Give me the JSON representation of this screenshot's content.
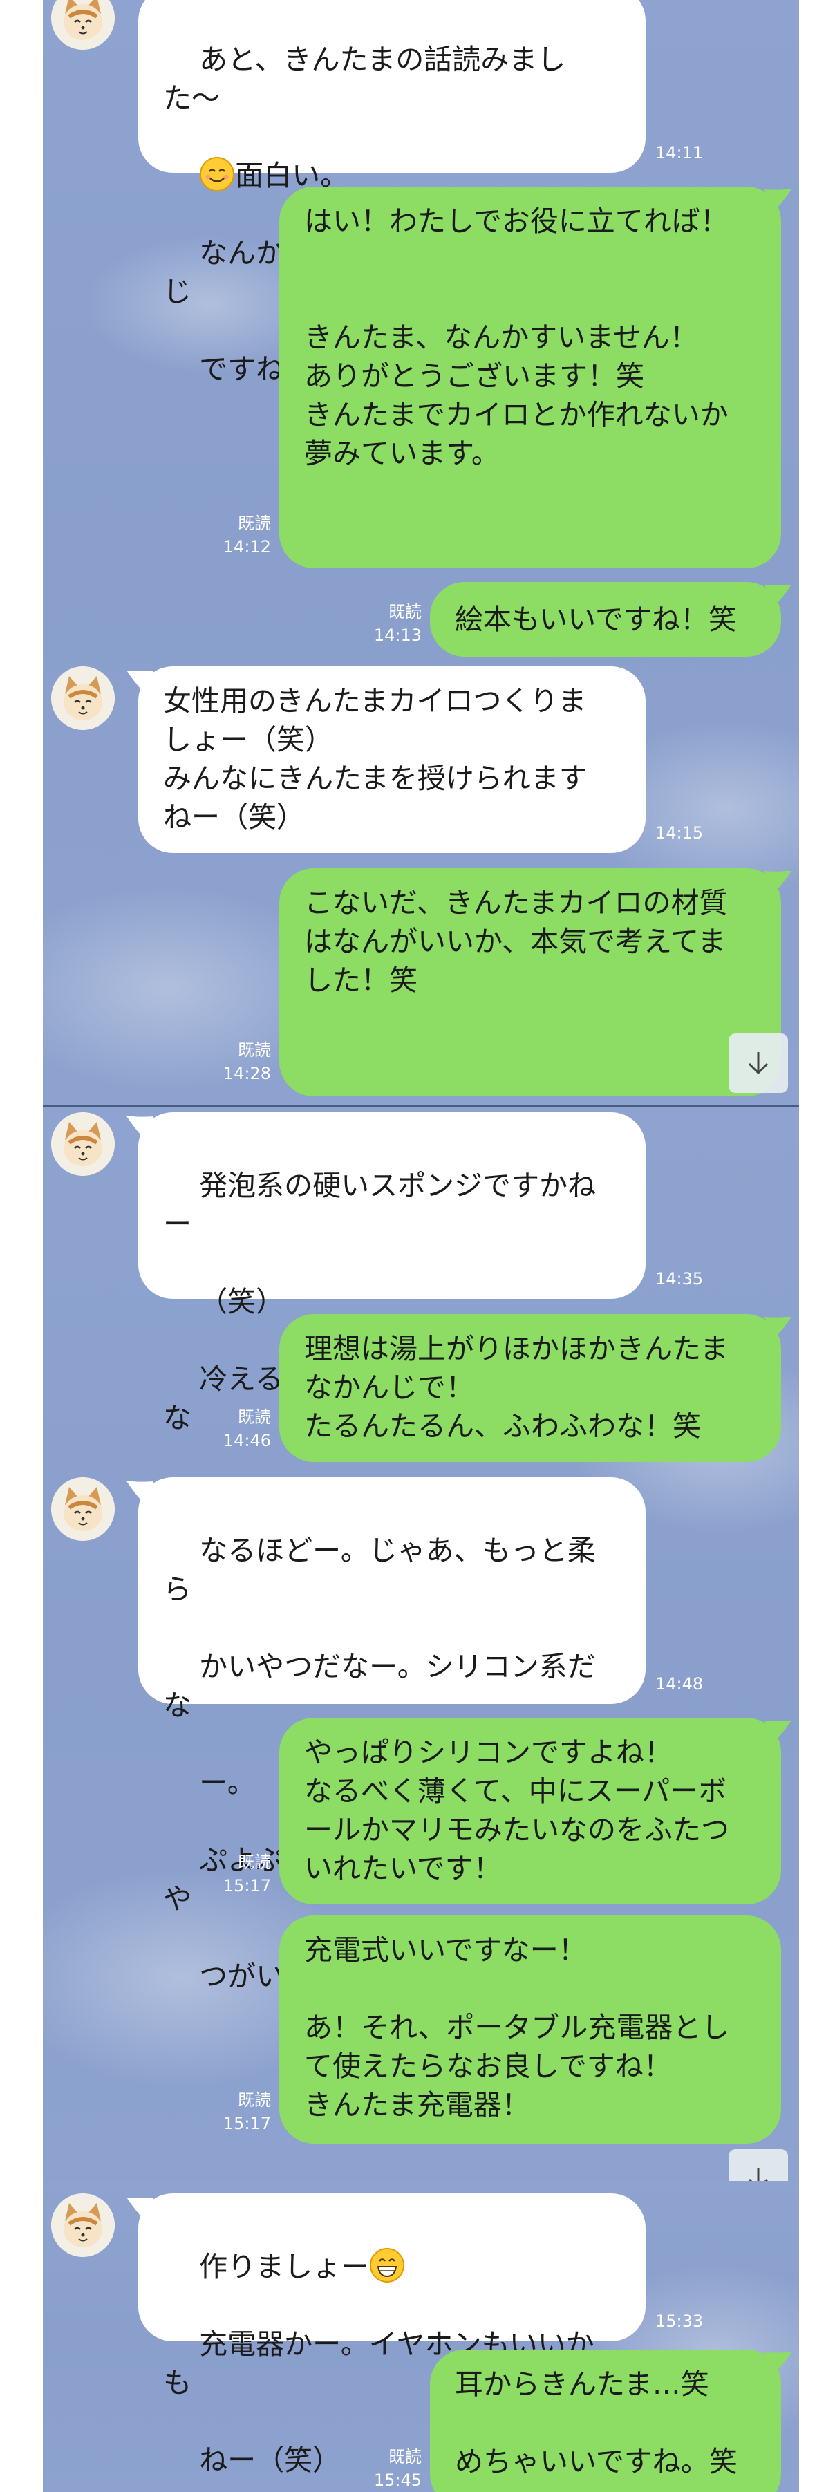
{
  "messages": [
    {
      "dir": "in",
      "lines": [
        "あと、きんたまの話読みました〜",
        "面白い。",
        "なんか、絵本とか作りたいかんじ",
        "ですね"
      ],
      "time": "14:11"
    },
    {
      "dir": "out",
      "text": "はい！わたしでお役に立てれば！\n\n\nきんたま、なんかすいません！\nありがとうございます！笑\nきんたまでカイロとか作れないか\n夢みています。",
      "read": "既読",
      "time": "14:12"
    },
    {
      "dir": "out",
      "text": "絵本もいいですね！笑",
      "read": "既読",
      "time": "14:13"
    },
    {
      "dir": "in",
      "text": "女性用のきんたまカイロつくりま\nしょー（笑）\nみんなにきんたまを授けられます\nねー（笑）",
      "time": "14:15"
    },
    {
      "dir": "out",
      "text": "こないだ、きんたまカイロの材質\nはなんがいいか、本気で考えてま\nした！笑",
      "read": "既読",
      "time": "14:28"
    },
    {
      "dir": "in",
      "lines": [
        "発泡系の硬いスポンジですかねー",
        "（笑）",
        "冷えると縮むとおもしろいだろな",
        "ー"
      ],
      "time": "14:35"
    },
    {
      "dir": "out",
      "text": "理想は湯上がりほかほかきんたま\nなかんじで！\nたるんたるん、ふわふわな！笑",
      "read": "既読",
      "time": "14:46"
    },
    {
      "dir": "in",
      "lines": [
        "なるほどー。じゃあ、もっと柔ら",
        "かいやつだなー。シリコン系だな",
        "ー。",
        "ぷよぷよで職場でも充電できるや",
        "つがいいっすねー"
      ],
      "time": "14:48"
    },
    {
      "dir": "out",
      "text": "やっぱりシリコンですよね！\nなるべく薄くて、中にスーパーボ\nールかマリモみたいなのをふたつ\nいれたいです！",
      "read": "既読",
      "time": "15:17"
    },
    {
      "dir": "out",
      "text": "充電式いいですなー！\n\nあ！それ、ポータブル充電器とし\nて使えたらなお良しですね！\nきんたま充電器！",
      "read": "既読",
      "time": "15:17"
    },
    {
      "dir": "in",
      "lines": [
        "作りましょー",
        "充電器かー。イヤホンもいいかも",
        "ねー（笑）"
      ],
      "time": "15:33"
    },
    {
      "dir": "out",
      "text": "耳からきんたま…笑\n\nめちゃいいですね。笑",
      "read": "既読",
      "time": "15:45"
    }
  ],
  "colors": {
    "background": "#8ea3cf",
    "out_bubble": "#8ddc64",
    "in_bubble": "#ffffff"
  },
  "icons": {
    "scroll_down": "arrow-down-icon",
    "avatar": "cat-avatar-icon",
    "emoji_smile": "smiling-face-emoji",
    "emoji_grin": "grinning-face-emoji"
  }
}
